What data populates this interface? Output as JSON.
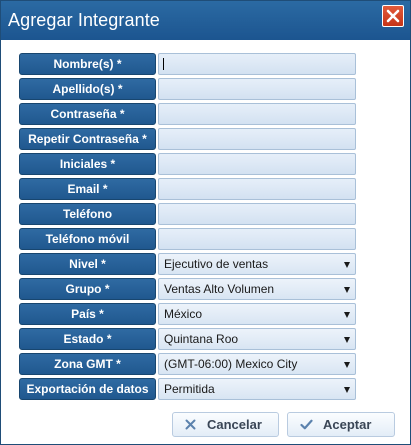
{
  "dialog": {
    "title": "Agregar Integrante"
  },
  "fields": [
    {
      "label": "Nombre(s) *",
      "value": ""
    },
    {
      "label": "Apellido(s) *",
      "value": ""
    },
    {
      "label": "Contraseña *",
      "value": ""
    },
    {
      "label": "Repetir Contraseña *",
      "value": ""
    },
    {
      "label": "Iniciales *",
      "value": ""
    },
    {
      "label": "Email *",
      "value": ""
    },
    {
      "label": "Teléfono",
      "value": ""
    },
    {
      "label": "Teléfono móvil",
      "value": ""
    }
  ],
  "selects": [
    {
      "label": "Nivel *",
      "value": "Ejecutivo de ventas"
    },
    {
      "label": "Grupo *",
      "value": "Ventas Alto Volumen"
    },
    {
      "label": "País *",
      "value": "México"
    },
    {
      "label": "Estado *",
      "value": "Quintana Roo"
    },
    {
      "label": "Zona GMT *",
      "value": "(GMT-06:00) Mexico City"
    },
    {
      "label": "Exportación de datos",
      "value": "Permitida"
    }
  ],
  "buttons": {
    "cancel": "Cancelar",
    "accept": "Aceptar"
  },
  "colors": {
    "title_bar": "#1c5590",
    "label_bg": "#2463a0",
    "input_bg": "#dce7f4",
    "close_button": "#d4441f"
  },
  "icons": {
    "close": "close-icon",
    "cancel": "x-icon",
    "accept": "check-icon",
    "dropdown": "chevron-down-icon"
  }
}
